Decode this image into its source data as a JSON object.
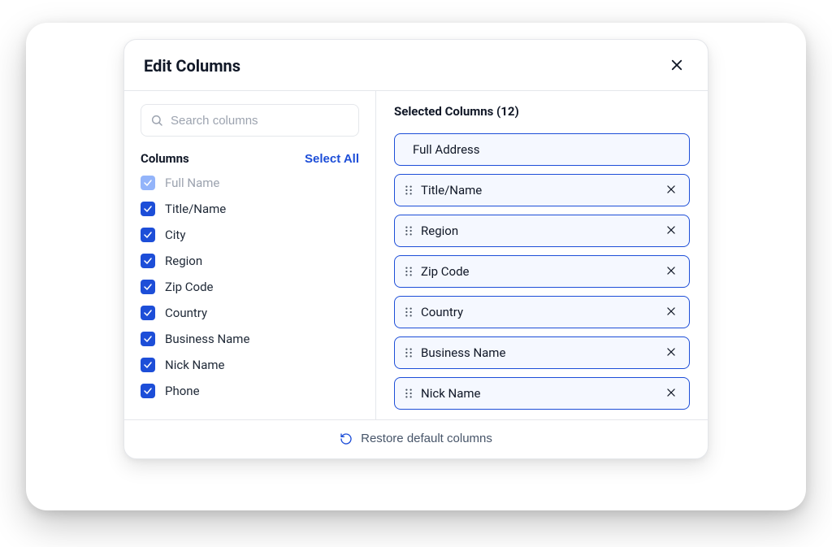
{
  "dialog": {
    "title": "Edit Columns",
    "close_label": "Close"
  },
  "search": {
    "placeholder": "Search columns"
  },
  "columns_section": {
    "heading": "Columns",
    "select_all_label": "Select All"
  },
  "columns": [
    {
      "label": "Full Name",
      "checked": true,
      "disabled": true
    },
    {
      "label": "Title/Name",
      "checked": true,
      "disabled": false
    },
    {
      "label": "City",
      "checked": true,
      "disabled": false
    },
    {
      "label": "Region",
      "checked": true,
      "disabled": false
    },
    {
      "label": "Zip Code",
      "checked": true,
      "disabled": false
    },
    {
      "label": "Country",
      "checked": true,
      "disabled": false
    },
    {
      "label": "Business Name",
      "checked": true,
      "disabled": false
    },
    {
      "label": "Nick Name",
      "checked": true,
      "disabled": false
    },
    {
      "label": "Phone",
      "checked": true,
      "disabled": false
    }
  ],
  "selected_section": {
    "heading_prefix": "Selected Columns",
    "count": 12,
    "heading": "Selected Columns (12)"
  },
  "selected": [
    {
      "label": "Full Address",
      "draggable": false,
      "removable": false
    },
    {
      "label": "Title/Name",
      "draggable": true,
      "removable": true
    },
    {
      "label": "Region",
      "draggable": true,
      "removable": true
    },
    {
      "label": "Zip Code",
      "draggable": true,
      "removable": true
    },
    {
      "label": "Country",
      "draggable": true,
      "removable": true
    },
    {
      "label": "Business Name",
      "draggable": true,
      "removable": true
    },
    {
      "label": "Nick Name",
      "draggable": true,
      "removable": true
    }
  ],
  "footer": {
    "restore_label": "Restore default columns"
  },
  "colors": {
    "accent": "#1d4ed8",
    "chip_bg": "#f5f8ff",
    "border": "#e5e7eb",
    "text": "#111827",
    "muted": "#9ca3af"
  }
}
